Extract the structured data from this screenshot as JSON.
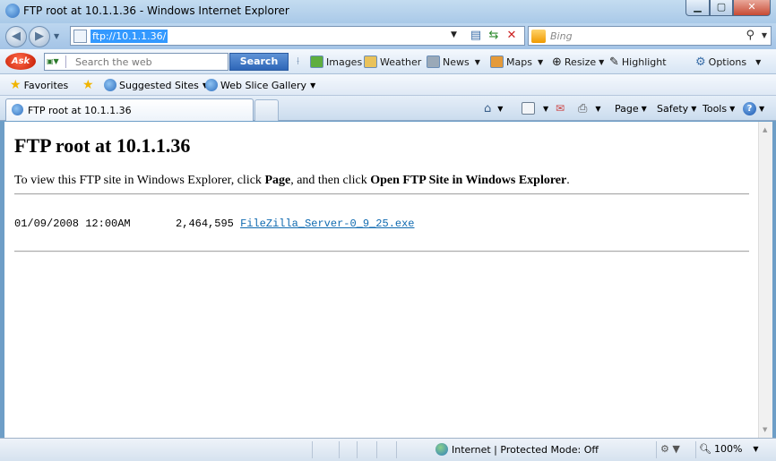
{
  "window": {
    "title": "FTP root at 10.1.1.36 - Windows Internet Explorer",
    "controls": {
      "minimize": "▁",
      "maximize": "▢",
      "close": "✕"
    }
  },
  "address_bar": {
    "url": "ftp://10.1.1.36/",
    "search_placeholder": "Bing",
    "icons": [
      "compatibility-icon",
      "refresh-icon",
      "stop-icon",
      "search-icon"
    ]
  },
  "ask_toolbar": {
    "logo": "Ask",
    "search_placeholder": "Search the web",
    "search_button": "Search",
    "items": [
      {
        "label": "Images",
        "icon": "images-icon",
        "dropdown": false
      },
      {
        "label": "Weather",
        "icon": "weather-icon",
        "dropdown": false
      },
      {
        "label": "News",
        "icon": "news-icon",
        "dropdown": true
      },
      {
        "label": "Maps",
        "icon": "maps-icon",
        "dropdown": true
      },
      {
        "label": "Resize",
        "icon": "resize-icon",
        "dropdown": true
      },
      {
        "label": "Highlight",
        "icon": "highlight-icon",
        "dropdown": false
      },
      {
        "label": "Options",
        "icon": "options-icon",
        "dropdown": true
      }
    ]
  },
  "favorites_bar": {
    "favorites": "Favorites",
    "suggested": "Suggested Sites",
    "web_slice": "Web Slice Gallery"
  },
  "tabs": {
    "active_tab": "FTP root at 10.1.1.36"
  },
  "command_bar": {
    "page": "Page",
    "safety": "Safety",
    "tools": "Tools"
  },
  "content": {
    "heading": "FTP root at 10.1.1.36",
    "intro_prefix": "To view this FTP site in Windows Explorer, click ",
    "intro_page": "Page",
    "intro_middle": ", and then click ",
    "intro_open": "Open FTP Site in Windows Explorer",
    "intro_suffix": ".",
    "files": [
      {
        "date": "01/09/2008 12:00AM",
        "size": "2,464,595",
        "name": "FileZilla_Server-0_9_25.exe"
      }
    ]
  },
  "status_bar": {
    "zone": "Internet | Protected Mode: Off",
    "zoom": "100%"
  },
  "colors": {
    "link": "#0f6ab0",
    "url_highlight": "#3399ff",
    "close_button": "#c74a34",
    "search_button": "#2e66b8"
  }
}
